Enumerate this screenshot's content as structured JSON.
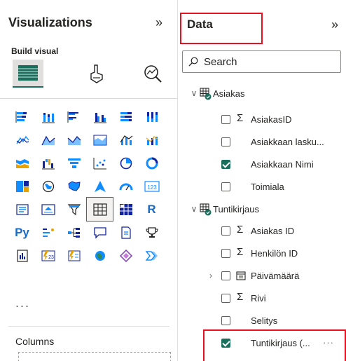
{
  "viz_pane": {
    "title": "Visualizations",
    "collapse_icon": "double-chevron-right-icon",
    "build_label": "Build visual",
    "tabs": [
      {
        "name": "build-visual",
        "icon": "table-visual-icon",
        "selected": true
      },
      {
        "name": "format-visual",
        "icon": "paintbrush-icon",
        "selected": false
      },
      {
        "name": "analytics",
        "icon": "magnifier-chart-icon",
        "selected": false
      }
    ],
    "python_label": "Py",
    "r_label": "R",
    "kpi_label": "123",
    "more": "...",
    "columns_label": "Columns"
  },
  "data_pane": {
    "title": "Data",
    "collapse_icon": "double-chevron-right-icon",
    "search_placeholder": "Search",
    "tables": [
      {
        "name": "Asiakas",
        "fields": [
          {
            "name": "AsiakasID",
            "sigma": true,
            "checked": false
          },
          {
            "name": "Asiakkaan lasku...",
            "sigma": false,
            "checked": false
          },
          {
            "name": "Asiakkaan Nimi",
            "sigma": false,
            "checked": true
          },
          {
            "name": "Toimiala",
            "sigma": false,
            "checked": false
          }
        ]
      },
      {
        "name": "Tuntikirjaus",
        "fields": [
          {
            "name": "Asiakas ID",
            "sigma": true,
            "checked": false
          },
          {
            "name": "Henkilön ID",
            "sigma": true,
            "checked": false
          },
          {
            "name": "Päivämäärä",
            "sigma": false,
            "checked": false,
            "hierarchy": true
          },
          {
            "name": "Rivi",
            "sigma": true,
            "checked": false
          },
          {
            "name": "Selitys",
            "sigma": false,
            "checked": false
          },
          {
            "name": "Tuntikirjaus (...",
            "sigma": false,
            "checked": true,
            "more": "···"
          }
        ]
      }
    ]
  },
  "colors": {
    "accent": "#1a6e5c",
    "highlight": "#e81123",
    "power_bi_blue": "#118dff",
    "power_bi_yellow": "#e8a200"
  }
}
